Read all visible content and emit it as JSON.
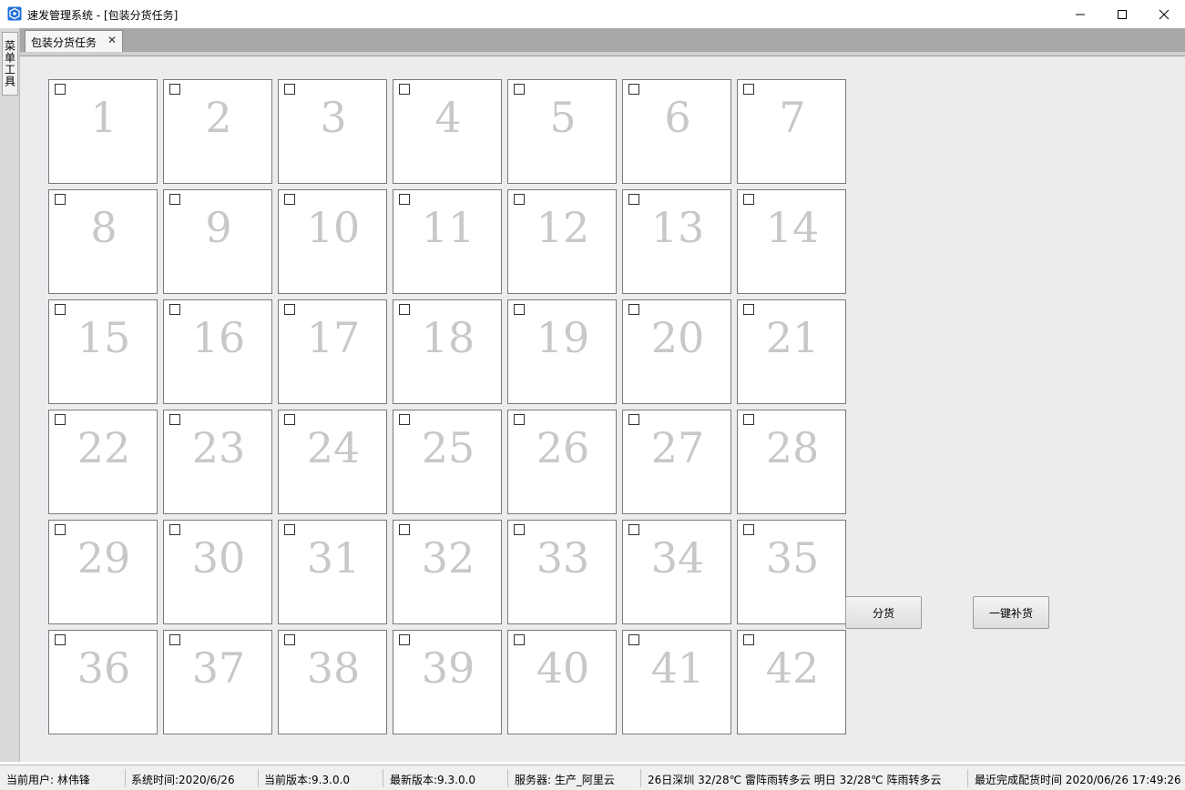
{
  "window": {
    "title": "速发管理系统 - [包装分货任务]",
    "icon": "app-logo-icon",
    "controls": [
      "minimize-icon",
      "maximize-icon",
      "close-icon"
    ]
  },
  "side_panel": {
    "tab_label": "菜单工具"
  },
  "tabs": [
    {
      "label": "包装分货任务",
      "close_glyph": "✕"
    }
  ],
  "grid": {
    "cells": [
      "1",
      "2",
      "3",
      "4",
      "5",
      "6",
      "7",
      "8",
      "9",
      "10",
      "11",
      "12",
      "13",
      "14",
      "15",
      "16",
      "17",
      "18",
      "19",
      "20",
      "21",
      "22",
      "23",
      "24",
      "25",
      "26",
      "27",
      "28",
      "29",
      "30",
      "31",
      "32",
      "33",
      "34",
      "35",
      "36",
      "37",
      "38",
      "39",
      "40",
      "41",
      "42"
    ]
  },
  "actions": {
    "distribute_label": "分货",
    "restock_label": "一键补货"
  },
  "status": {
    "current_user": "当前用户: 林伟锋",
    "system_time": "系统时间:2020/6/26",
    "current_version": "当前版本:9.3.0.0",
    "latest_version": "最新版本:9.3.0.0",
    "server": "服务器:  生产_阿里云",
    "weather": "26日深圳 32/28℃ 雷阵雨转多云 明日 32/28℃ 阵雨转多云",
    "last_completed": "最近完成配货时间 2020/06/26 17:49:26"
  },
  "colors": {
    "tab_header": "#a8a8a8",
    "content_bg": "#ececef",
    "cell_number": "#c8c8c8",
    "app_icon": "#1e6fd9"
  }
}
